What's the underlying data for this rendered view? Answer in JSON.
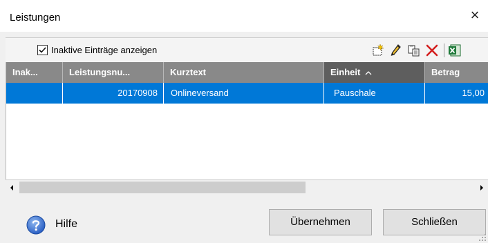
{
  "window": {
    "title": "Leistungen"
  },
  "toolbar": {
    "checkbox_label": "Inaktive Einträge anzeigen",
    "checkbox_checked": true,
    "icons": [
      "new-entry-icon",
      "edit-pencil-icon",
      "copy-icon",
      "delete-icon",
      "excel-export-icon"
    ]
  },
  "table": {
    "columns": [
      "Inak...",
      "Leistungsnu...",
      "Kurztext",
      "Einheit",
      "Betrag"
    ],
    "sort_column": "Einheit",
    "sort_direction": "ascending",
    "rows": [
      {
        "inaktiv": "",
        "leistungsnummer": "20170908",
        "kurztext": "Onlineversand",
        "einheit": "Pauschale",
        "betrag": "15,00"
      }
    ]
  },
  "footer": {
    "help_label": "Hilfe",
    "apply_label": "Übernehmen",
    "close_label": "Schließen"
  },
  "colors": {
    "selection": "#0078d7",
    "header": "#898989",
    "sorted_header": "#5e5e5e"
  }
}
